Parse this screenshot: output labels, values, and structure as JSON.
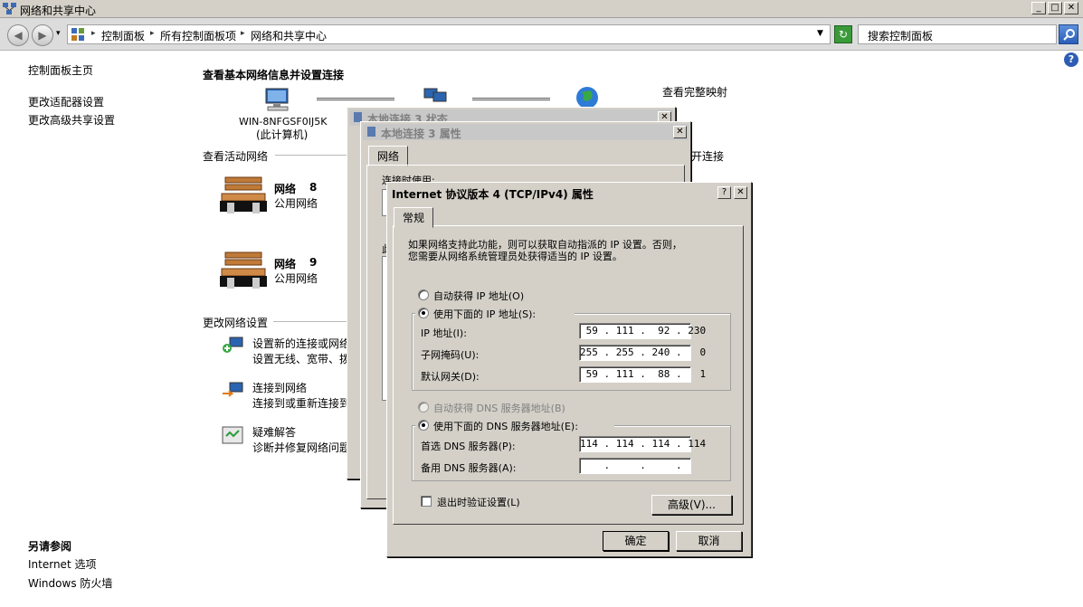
{
  "window": {
    "title": "网络和共享中心",
    "minimize": "_",
    "maximize": "□",
    "close": "✕"
  },
  "nav": {
    "back": "◀",
    "forward": "▶",
    "breadcrumbs": [
      "控制面板",
      "所有控制面板项",
      "网络和共享中心"
    ],
    "search_placeholder": "搜索控制面板",
    "help": "?"
  },
  "left_pane": {
    "home": "控制面板主页",
    "links": [
      "更改适配器设置",
      "更改高级共享设置"
    ],
    "see_also_title": "另请参阅",
    "see_also": [
      "Internet 选项",
      "Windows 防火墙"
    ]
  },
  "main": {
    "heading": "查看基本网络信息并设置连接",
    "computer_name": "WIN-8NFGSF0IJ5K",
    "computer_note": "(此计算机)",
    "full_map_link": "查看完整映射",
    "active_networks_heading": "查看活动网络",
    "disconnect_link": "开连接",
    "networks": [
      {
        "name": "网络",
        "number": "8",
        "type": "公用网络"
      },
      {
        "name": "网络",
        "number": "9",
        "type": "公用网络"
      }
    ],
    "change_settings_heading": "更改网络设置",
    "tasks": [
      {
        "title": "设置新的连接或网络",
        "desc": "设置无线、宽带、拨"
      },
      {
        "title": "连接到网络",
        "desc": "连接到或重新连接到"
      },
      {
        "title": "疑难解答",
        "desc": "诊断并修复网络问题"
      }
    ]
  },
  "status_dialog": {
    "title": "本地连接 3 状态",
    "close": "✕"
  },
  "props_dialog": {
    "title": "本地连接 3 属性",
    "close": "✕",
    "tab": "网络",
    "connect_using": "连接时使用:",
    "item_label": "此"
  },
  "ipv4_dialog": {
    "title": "Internet 协议版本 4 (TCP/IPv4) 属性",
    "help": "?",
    "close": "✕",
    "tab": "常规",
    "intro_line1": "如果网络支持此功能，则可以获取自动指派的 IP 设置。否则，",
    "intro_line2": "您需要从网络系统管理员处获得适当的 IP 设置。",
    "auto_ip": "自动获得 IP 地址(O)",
    "use_ip": "使用下面的 IP 地址(S):",
    "ip_label": "IP 地址(I):",
    "ip_value": " 59 . 111 .  92 . 230",
    "mask_label": "子网掩码(U):",
    "mask_value": "255 . 255 . 240 .   0",
    "gateway_label": "默认网关(D):",
    "gateway_value": " 59 . 111 .  88 .   1",
    "auto_dns": "自动获得 DNS 服务器地址(B)",
    "use_dns": "使用下面的 DNS 服务器地址(E):",
    "pref_dns_label": "首选 DNS 服务器(P):",
    "pref_dns_value": "114 . 114 . 114 . 114",
    "alt_dns_label": "备用 DNS 服务器(A):",
    "alt_dns_value": "    .     .     .    ",
    "validate": "退出时验证设置(L)",
    "advanced": "高级(V)...",
    "ok": "确定",
    "cancel": "取消"
  }
}
